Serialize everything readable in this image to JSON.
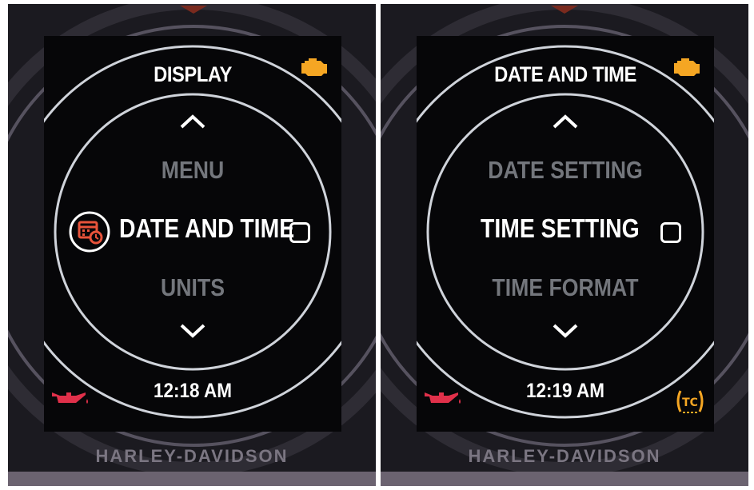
{
  "left_screen": {
    "title": "DISPLAY",
    "items": [
      "MENU",
      "DATE AND TIME",
      "UNITS"
    ],
    "clock": "12:18 AM",
    "brand": "HARLEY-DAVIDSON",
    "icons": {
      "engine": "check-engine-icon",
      "oil": "oil-pressure-icon",
      "selected_item_icon": "calendar-clock-icon"
    }
  },
  "right_screen": {
    "title": "DATE AND TIME",
    "items": [
      "DATE SETTING",
      "TIME SETTING",
      "TIME FORMAT"
    ],
    "clock": "12:19 AM",
    "brand": "HARLEY-DAVIDSON",
    "icons": {
      "engine": "check-engine-icon",
      "oil": "oil-pressure-icon",
      "traction": "traction-control-icon"
    }
  },
  "colors": {
    "warning_amber": "#f5a623",
    "warning_red": "#e0304a",
    "selected_icon_red": "#e8533a",
    "dim_text": "#73767c",
    "ring": "#cfd3da"
  }
}
